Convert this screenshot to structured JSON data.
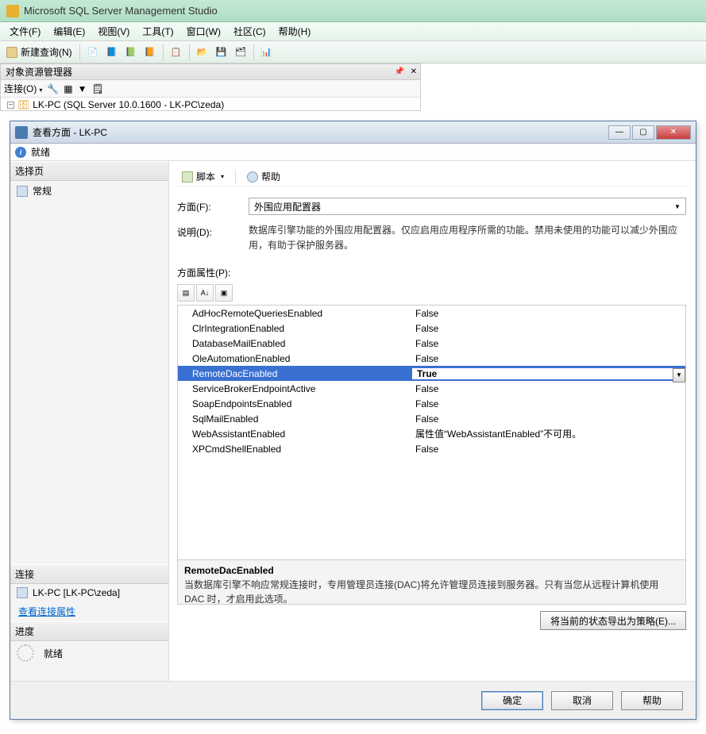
{
  "app": {
    "title": "Microsoft SQL Server Management Studio"
  },
  "menu": {
    "file": "文件(F)",
    "edit": "编辑(E)",
    "view": "视图(V)",
    "tools": "工具(T)",
    "window": "窗口(W)",
    "community": "社区(C)",
    "help": "帮助(H)"
  },
  "toolbar": {
    "new_query": "新建查询(N)"
  },
  "explorer": {
    "title": "对象资源管理器",
    "connect": "连接(O)",
    "node": "LK-PC (SQL Server 10.0.1600 - LK-PC\\zeda)"
  },
  "dialog": {
    "title": "查看方面 - LK-PC",
    "status_ready": "就绪",
    "left": {
      "select_page": "选择页",
      "general": "常规",
      "connection": "连接",
      "conn_value": "LK-PC [LK-PC\\zeda]",
      "view_conn_props": "查看连接属性",
      "progress": "进度",
      "progress_ready": "就绪"
    },
    "right": {
      "script": "脚本",
      "help": "帮助",
      "facet_label": "方面(F):",
      "facet_value": "外围应用配置器",
      "desc_label": "说明(D):",
      "desc_value": "数据库引擎功能的外围应用配置器。仅应启用应用程序所需的功能。禁用未使用的功能可以减少外围应用，有助于保护服务器。",
      "props_label": "方面属性(P):",
      "properties": [
        {
          "name": "AdHocRemoteQueriesEnabled",
          "value": "False"
        },
        {
          "name": "ClrIntegrationEnabled",
          "value": "False"
        },
        {
          "name": "DatabaseMailEnabled",
          "value": "False"
        },
        {
          "name": "OleAutomationEnabled",
          "value": "False"
        },
        {
          "name": "RemoteDacEnabled",
          "value": "True",
          "selected": true
        },
        {
          "name": "ServiceBrokerEndpointActive",
          "value": "False"
        },
        {
          "name": "SoapEndpointsEnabled",
          "value": "False"
        },
        {
          "name": "SqlMailEnabled",
          "value": "False"
        },
        {
          "name": "WebAssistantEnabled",
          "value": "属性值“WebAssistantEnabled”不可用。"
        },
        {
          "name": "XPCmdShellEnabled",
          "value": "False"
        }
      ],
      "help_title": "RemoteDacEnabled",
      "help_desc": "当数据库引擎不响应常规连接时，专用管理员连接(DAC)将允许管理员连接到服务器。只有当您从远程计算机使用 DAC 时，才启用此选项。",
      "export_btn": "将当前的状态导出为策略(E)..."
    },
    "buttons": {
      "ok": "确定",
      "cancel": "取消",
      "help": "帮助"
    }
  }
}
